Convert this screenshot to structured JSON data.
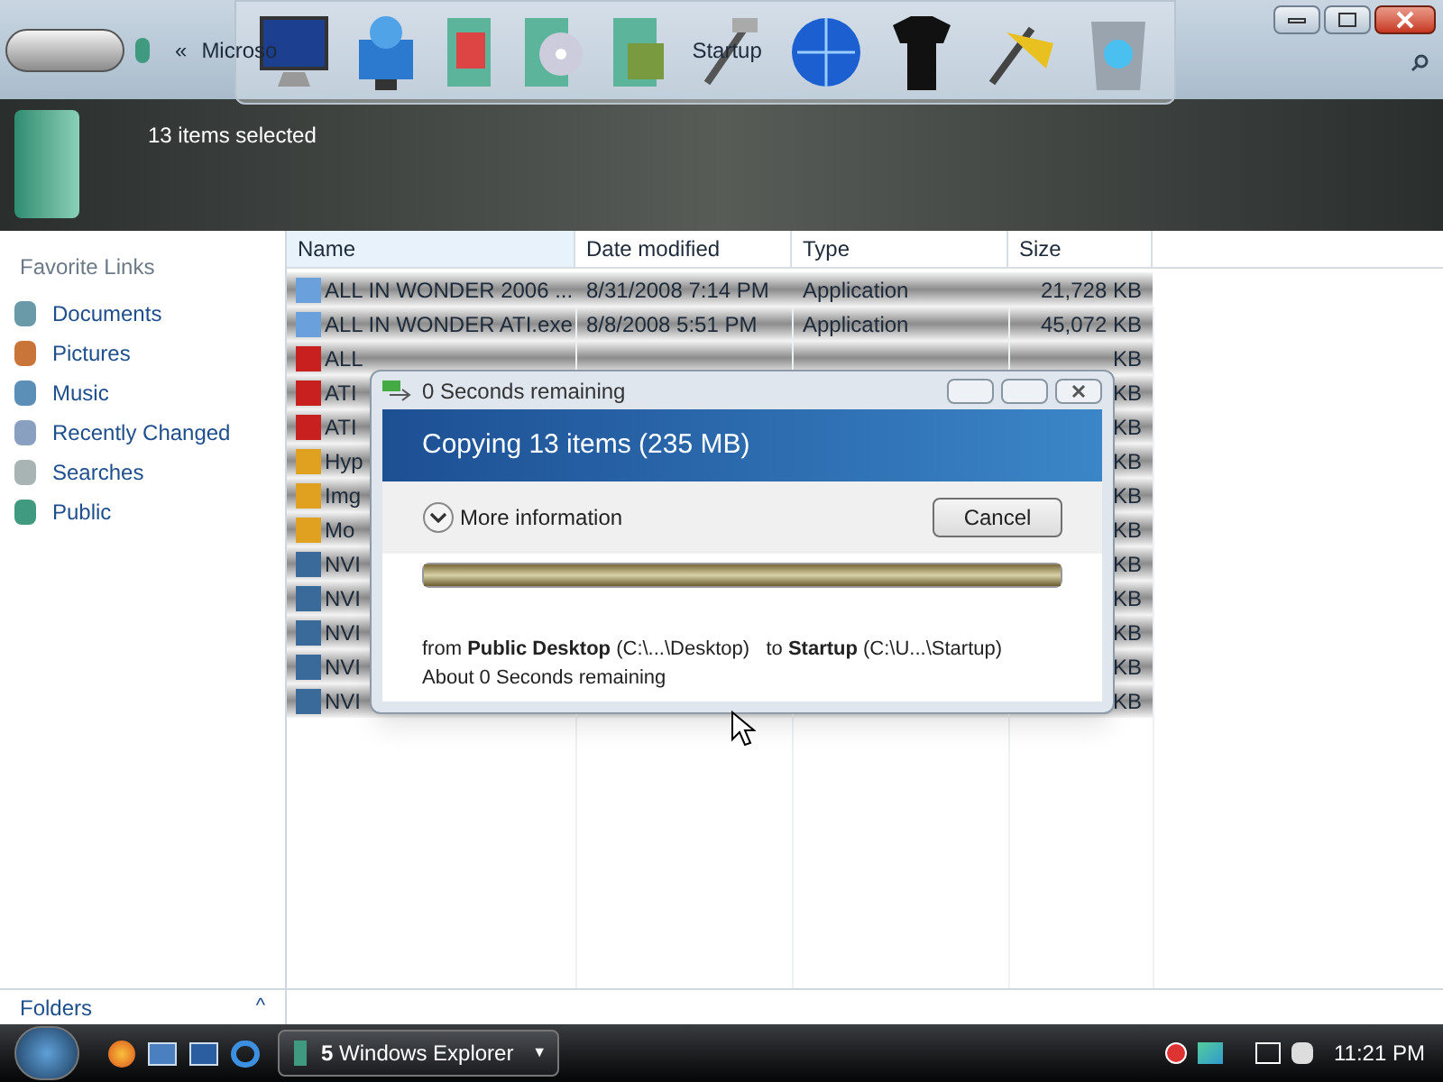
{
  "address_bar": {
    "segments": [
      "«",
      "Microso",
      "Startup"
    ]
  },
  "details_pane": {
    "text": "13 items selected"
  },
  "favorite_links": {
    "title": "Favorite Links",
    "items": [
      {
        "label": "Documents",
        "kind": "documents"
      },
      {
        "label": "Pictures",
        "kind": "pictures"
      },
      {
        "label": "Music",
        "kind": "music"
      },
      {
        "label": "Recently Changed",
        "kind": "recent"
      },
      {
        "label": "Searches",
        "kind": "searches"
      },
      {
        "label": "Public",
        "kind": "public"
      }
    ]
  },
  "folders_bar": {
    "label": "Folders",
    "arrow": "^"
  },
  "file_list": {
    "columns": [
      "Name",
      "Date modified",
      "Type",
      "Size"
    ],
    "rows": [
      {
        "name": "ALL IN WONDER 2006 ...",
        "date": "8/31/2008 7:14 PM",
        "type": "Application",
        "size": "21,728 KB",
        "kind": "app"
      },
      {
        "name": "ALL IN WONDER ATI.exe",
        "date": "8/8/2008 5:51 PM",
        "type": "Application",
        "size": "45,072 KB",
        "kind": "app"
      },
      {
        "name": "ALL",
        "size": "KB",
        "kind": "ati"
      },
      {
        "name": "ATI",
        "size": "KB",
        "kind": "ati"
      },
      {
        "name": "ATI",
        "size": "KB",
        "kind": "ati"
      },
      {
        "name": "Hyp",
        "size": "KB",
        "kind": "shortcut"
      },
      {
        "name": "Img",
        "size": "KB",
        "kind": "shortcut"
      },
      {
        "name": "Mo",
        "size": "KB",
        "kind": "shortcut"
      },
      {
        "name": "NVI",
        "size": "KB",
        "kind": "nvidia"
      },
      {
        "name": "NVI",
        "size": "KB",
        "kind": "nvidia"
      },
      {
        "name": "NVI",
        "size": "KB",
        "kind": "nvidia"
      },
      {
        "name": "NVI",
        "size": "KB",
        "kind": "nvidia"
      },
      {
        "name": "NVI",
        "size": "KB",
        "kind": "nvidia"
      }
    ]
  },
  "copy_dialog": {
    "title": "0 Seconds remaining",
    "heading": "Copying 13 items (235 MB)",
    "more_info": "More information",
    "cancel": "Cancel",
    "progress": {
      "level": 1
    },
    "from_line": "from **Public Desktop** (C:\\...\\Desktop)   to **Startup** (C:\\U...\\Startup)",
    "remaining": "About 0 Seconds remaining"
  },
  "taskbar": {
    "task_button": "**5** Windows Explorer",
    "menu_arrow": "▼",
    "time": "11:21 PM"
  }
}
